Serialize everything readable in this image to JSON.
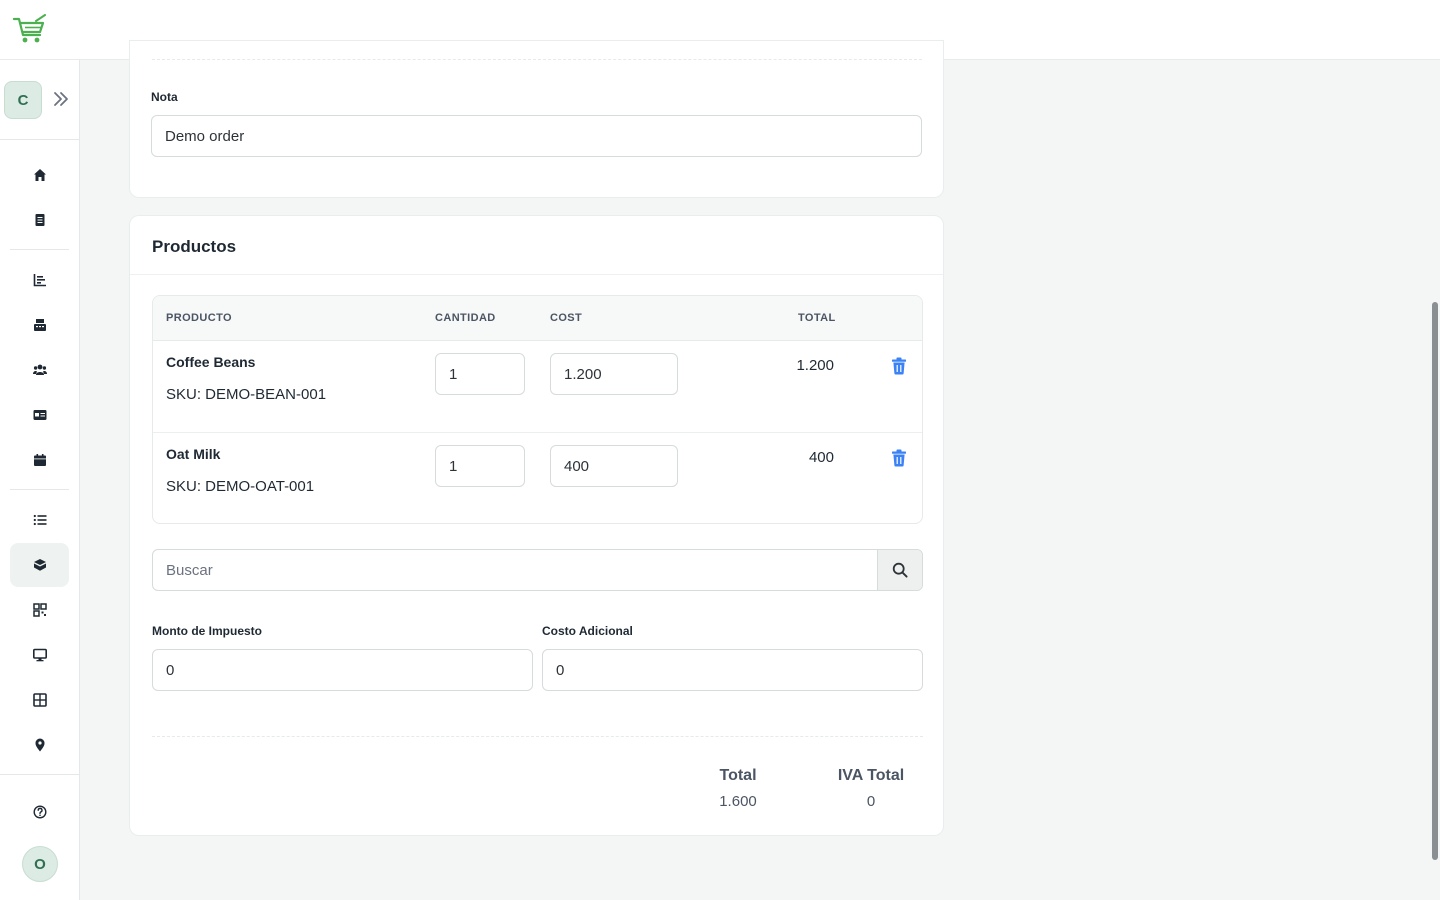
{
  "colors": {
    "brand_green": "#4caf50",
    "accent_blue": "#3b82f6",
    "avatar_bg": "#dcebe4"
  },
  "sidebar": {
    "workspace_initial": "C",
    "user_initial": "O",
    "items": [
      {
        "icon": "home-icon"
      },
      {
        "icon": "receipt-icon"
      },
      {
        "icon": "bar-chart-icon"
      },
      {
        "icon": "cash-register-icon"
      },
      {
        "icon": "users-icon"
      },
      {
        "icon": "id-card-icon"
      },
      {
        "icon": "calendar-icon"
      },
      {
        "icon": "list-icon"
      },
      {
        "icon": "box-icon",
        "active": true
      },
      {
        "icon": "qr-code-icon"
      },
      {
        "icon": "desktop-icon"
      },
      {
        "icon": "table-grid-icon"
      },
      {
        "icon": "location-pin-icon"
      },
      {
        "icon": "help-icon"
      }
    ]
  },
  "note": {
    "label": "Nota",
    "value": "Demo order"
  },
  "products": {
    "title": "Productos",
    "columns": {
      "product": "PRODUCTO",
      "quantity": "CANTIDAD",
      "cost": "COST",
      "total": "TOTAL"
    },
    "rows": [
      {
        "name": "Coffee Beans",
        "sku": "SKU: DEMO-BEAN-001",
        "quantity": "1",
        "cost": "1.200",
        "total": "1.200"
      },
      {
        "name": "Oat Milk",
        "sku": "SKU: DEMO-OAT-001",
        "quantity": "1",
        "cost": "400",
        "total": "400"
      }
    ],
    "search_placeholder": "Buscar",
    "tax": {
      "label": "Monto de Impuesto",
      "value": "0"
    },
    "additional_cost": {
      "label": "Costo Adicional",
      "value": "0"
    },
    "summary": {
      "total_label": "Total",
      "total_value": "1.600",
      "iva_label": "IVA Total",
      "iva_value": "0"
    }
  }
}
